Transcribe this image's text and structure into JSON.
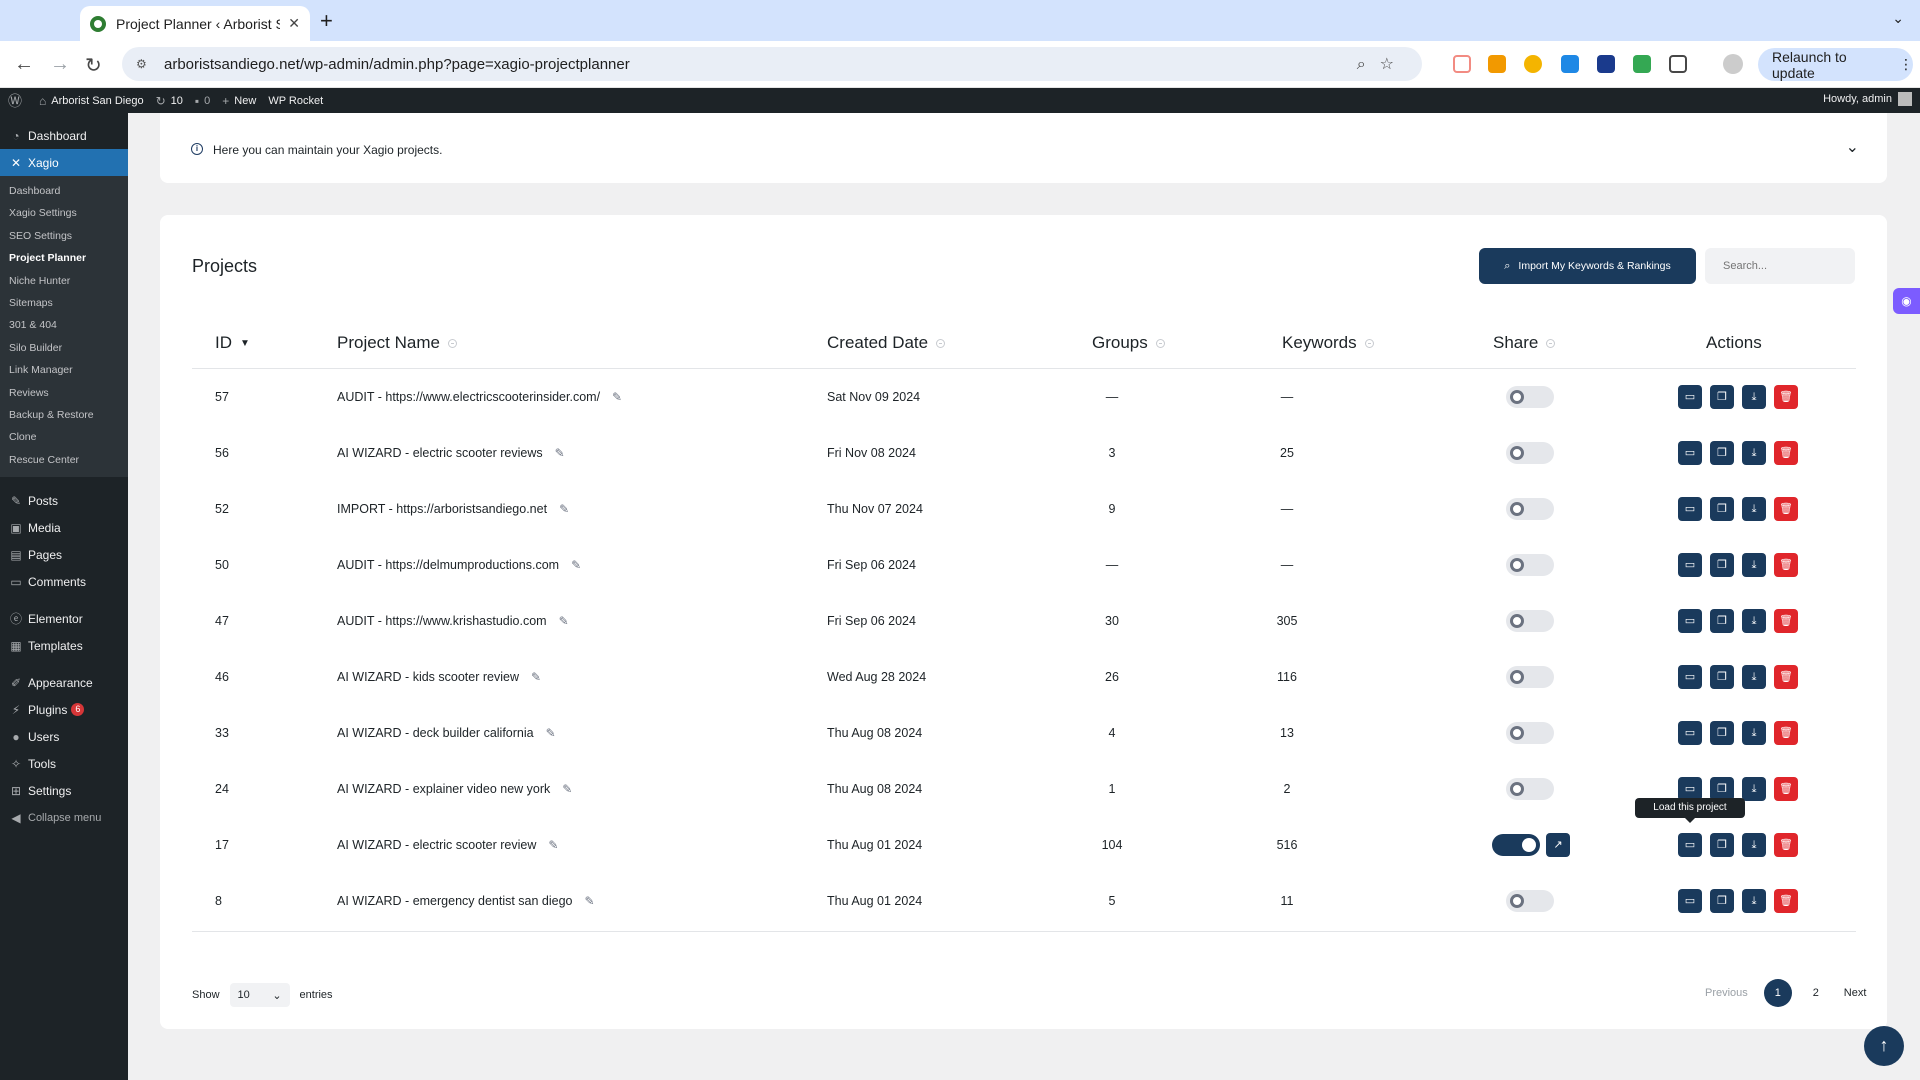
{
  "browser": {
    "tab_title": "Project Planner ‹ Arborist San",
    "tab_close": "✕",
    "new_tab": "+",
    "tab_menu": "⌄",
    "url": "arboristsandiego.net/wp-admin/admin.php?page=xagio-projectplanner",
    "relaunch_label": "Relaunch to update",
    "relaunch_menu": "⋮"
  },
  "adminbar": {
    "site_name": "Arborist San Diego",
    "updates_count": "10",
    "comments_count": "0",
    "new_label": "New",
    "wp_rocket": "WP Rocket",
    "howdy": "Howdy, admin"
  },
  "sidebar": {
    "dashboard": "Dashboard",
    "xagio": "Xagio",
    "sub_items": [
      "Dashboard",
      "Xagio Settings",
      "SEO Settings",
      "Project Planner",
      "Niche Hunter",
      "Sitemaps",
      "301 & 404",
      "Silo Builder",
      "Link Manager",
      "Reviews",
      "Backup & Restore",
      "Clone",
      "Rescue Center"
    ],
    "posts": "Posts",
    "media": "Media",
    "pages": "Pages",
    "comments": "Comments",
    "elementor": "Elementor",
    "templates": "Templates",
    "appearance": "Appearance",
    "plugins": "Plugins",
    "plugins_badge": "6",
    "users": "Users",
    "tools": "Tools",
    "settings": "Settings",
    "collapse": "Collapse menu"
  },
  "info": {
    "text": "Here you can maintain your Xagio projects."
  },
  "projects": {
    "title": "Projects",
    "import_label": "Import My Keywords & Rankings",
    "search_placeholder": "Search...",
    "columns": {
      "id": "ID",
      "name": "Project Name",
      "date": "Created Date",
      "groups": "Groups",
      "keywords": "Keywords",
      "share": "Share",
      "actions": "Actions"
    },
    "rows": [
      {
        "id": "57",
        "name": "AUDIT - https://www.electricscooterinsider.com/",
        "date": "Sat Nov 09 2024",
        "groups": "—",
        "keywords": "—",
        "shared": false
      },
      {
        "id": "56",
        "name": "AI WIZARD - electric scooter reviews",
        "date": "Fri Nov 08 2024",
        "groups": "3",
        "keywords": "25",
        "shared": false
      },
      {
        "id": "52",
        "name": "IMPORT - https://arboristsandiego.net",
        "date": "Thu Nov 07 2024",
        "groups": "9",
        "keywords": "—",
        "shared": false
      },
      {
        "id": "50",
        "name": "AUDIT - https://delmumproductions.com",
        "date": "Fri Sep 06 2024",
        "groups": "—",
        "keywords": "—",
        "shared": false
      },
      {
        "id": "47",
        "name": "AUDIT - https://www.krishastudio.com",
        "date": "Fri Sep 06 2024",
        "groups": "30",
        "keywords": "305",
        "shared": false
      },
      {
        "id": "46",
        "name": "AI WIZARD - kids scooter review",
        "date": "Wed Aug 28 2024",
        "groups": "26",
        "keywords": "116",
        "shared": false
      },
      {
        "id": "33",
        "name": "AI WIZARD - deck builder california",
        "date": "Thu Aug 08 2024",
        "groups": "4",
        "keywords": "13",
        "shared": false
      },
      {
        "id": "24",
        "name": "AI WIZARD - explainer video new york",
        "date": "Thu Aug 08 2024",
        "groups": "1",
        "keywords": "2",
        "shared": false
      },
      {
        "id": "17",
        "name": "AI WIZARD - electric scooter review",
        "date": "Thu Aug 01 2024",
        "groups": "104",
        "keywords": "516",
        "shared": true
      },
      {
        "id": "8",
        "name": "AI WIZARD - emergency dentist san diego",
        "date": "Thu Aug 01 2024",
        "groups": "5",
        "keywords": "11",
        "shared": false
      }
    ],
    "show_label": "Show",
    "entries_value": "10",
    "entries_label": "entries",
    "previous": "Previous",
    "pages": [
      "1",
      "2"
    ],
    "next": "Next",
    "tooltip": "Load this project"
  },
  "colors": {
    "accent": "#1a3a5c",
    "delete": "#e0262b",
    "wp_active": "#2271b1"
  }
}
